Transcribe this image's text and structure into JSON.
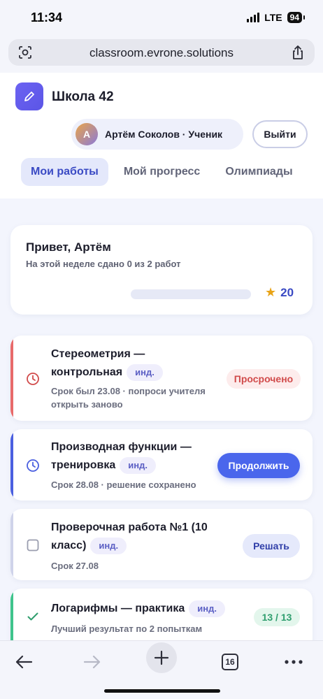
{
  "status_bar": {
    "time": "11:34",
    "network": "LTE",
    "battery": "94"
  },
  "browser": {
    "url": "classroom.evrone.solutions",
    "tab_count": "16"
  },
  "header": {
    "school_name": "Школа 42",
    "avatar_initial": "А",
    "user_label": "Артём Соколов · Ученик",
    "logout_label": "Выйти",
    "tabs": [
      {
        "label": "Мои работы",
        "active": true
      },
      {
        "label": "Мой прогресс",
        "active": false
      },
      {
        "label": "Олимпиады",
        "active": false
      }
    ]
  },
  "greeting": {
    "title": "Привет, Артём",
    "subtitle": "На этой неделе сдано 0 из 2 работ",
    "progress_fraction": 0,
    "stars": "20"
  },
  "tasks": [
    {
      "title": "Стереометрия — контрольная",
      "tag": "инд.",
      "meta": "Срок был 23.08 · попроси учителя открыть заново",
      "status_label": "Просрочено",
      "state": "overdue",
      "accent": "#e86a6a"
    },
    {
      "title": "Производная функции — тренировка",
      "tag": "инд.",
      "meta": "Срок 28.08 · решение сохранено",
      "action_label": "Продолжить",
      "state": "in_progress",
      "accent": "#4a5fe0"
    },
    {
      "title": "Проверочная работа №1 (10 класс)",
      "tag": "инд.",
      "meta": "Срок 27.08",
      "action_label": "Решать",
      "state": "todo",
      "accent": "#cfd3ea"
    },
    {
      "title": "Логарифмы — практика",
      "tag": "инд.",
      "meta": "Лучший результат по 2 попыткам",
      "score_label": "13 / 13",
      "state": "done",
      "accent": "#3fc48c"
    }
  ],
  "colors": {
    "brand": "#5b55e6",
    "primary": "#4a5fe0",
    "danger": "#d14b4b",
    "success": "#2f9e6e"
  },
  "icons": [
    "camera-lens-icon",
    "share-icon",
    "pencil-icon",
    "star-icon",
    "clock-icon",
    "checkbox-icon",
    "checkmark-icon",
    "back-arrow-icon",
    "forward-arrow-icon",
    "plus-icon",
    "tabs-icon",
    "more-icon"
  ]
}
